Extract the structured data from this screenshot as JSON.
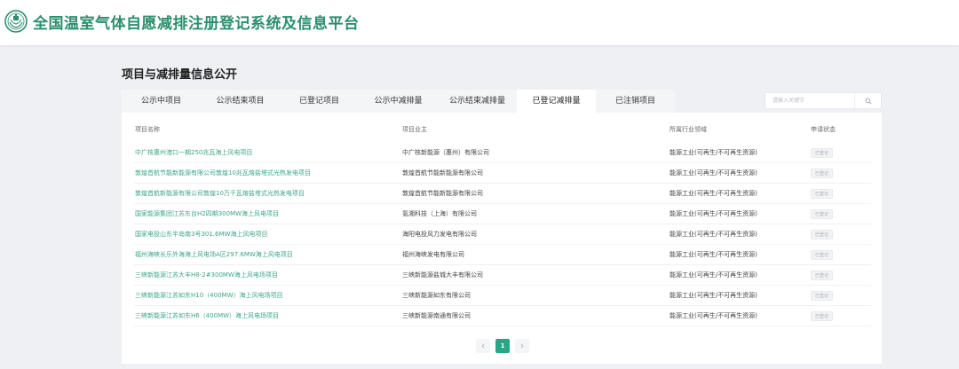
{
  "header": {
    "title": "全国温室气体自愿减排注册登记系统及信息平台",
    "logo_icon": "emblem-logo-icon",
    "brand_color": "#2b8f6c"
  },
  "section": {
    "title": "项目与减排量信息公开"
  },
  "tabs": [
    {
      "label": "公示中项目",
      "active": false
    },
    {
      "label": "公示结束项目",
      "active": false
    },
    {
      "label": "已登记项目",
      "active": false
    },
    {
      "label": "公示中减排量",
      "active": false
    },
    {
      "label": "公示结束减排量",
      "active": false
    },
    {
      "label": "已登记减排量",
      "active": true
    },
    {
      "label": "已注销项目",
      "active": false
    }
  ],
  "search": {
    "placeholder": "请输入关键字",
    "icon": "search-icon"
  },
  "table": {
    "columns": [
      "项目名称",
      "项目业主",
      "所属行业领域",
      "申请状态"
    ],
    "rows": [
      {
        "name": "中广核惠州港口一期250兆瓦海上风电项目",
        "owner": "中广核新能源（惠州）有限公司",
        "industry": "能源工业(可再生/不可再生资源)",
        "status": "已登记"
      },
      {
        "name": "敦煌首航节能新能源有限公司敦煌10兆瓦熔盐塔式光热发电项目",
        "owner": "敦煌首航节能新能源有限公司",
        "industry": "能源工业(可再生/不可再生资源)",
        "status": "已登记"
      },
      {
        "name": "敦煌首航新能源有限公司敦煌10万千瓦熔盐塔式光热发电项目",
        "owner": "敦煌首航节能新能源有限公司",
        "industry": "能源工业(可再生/不可再生资源)",
        "status": "已登记"
      },
      {
        "name": "国家能源集团江苏东台H2四期300MW海上风电项目",
        "owner": "氢湘科技（上海）有限公司",
        "industry": "能源工业(可再生/不可再生资源)",
        "status": "已登记"
      },
      {
        "name": "国家电投山东半岛南3号301.6MW海上风电项目",
        "owner": "海阳电投风力发电有限公司",
        "industry": "能源工业(可再生/不可再生资源)",
        "status": "已登记"
      },
      {
        "name": "福州海峡长乐外海海上风电场A区297.6MW海上风电项目",
        "owner": "福州海峡发电有限公司",
        "industry": "能源工业(可再生/不可再生资源)",
        "status": "已登记"
      },
      {
        "name": "三峡新能源江苏大丰H8-2#300MW海上风电场项目",
        "owner": "三峡新能源盐城大丰有限公司",
        "industry": "能源工业(可再生/不可再生资源)",
        "status": "已登记"
      },
      {
        "name": "三峡新能源江苏如东H10（400MW）海上风电场项目",
        "owner": "三峡新能源如东有限公司",
        "industry": "能源工业(可再生/不可再生资源)",
        "status": "已登记"
      },
      {
        "name": "三峡新能源江苏如东H6（400MW）海上风电场项目",
        "owner": "三峡新能源南通有限公司",
        "industry": "能源工业(可再生/不可再生资源)",
        "status": "已登记"
      }
    ]
  },
  "pagination": {
    "current_page": "1",
    "prev_icon": "chevron-left-icon",
    "next_icon": "chevron-right-icon"
  }
}
